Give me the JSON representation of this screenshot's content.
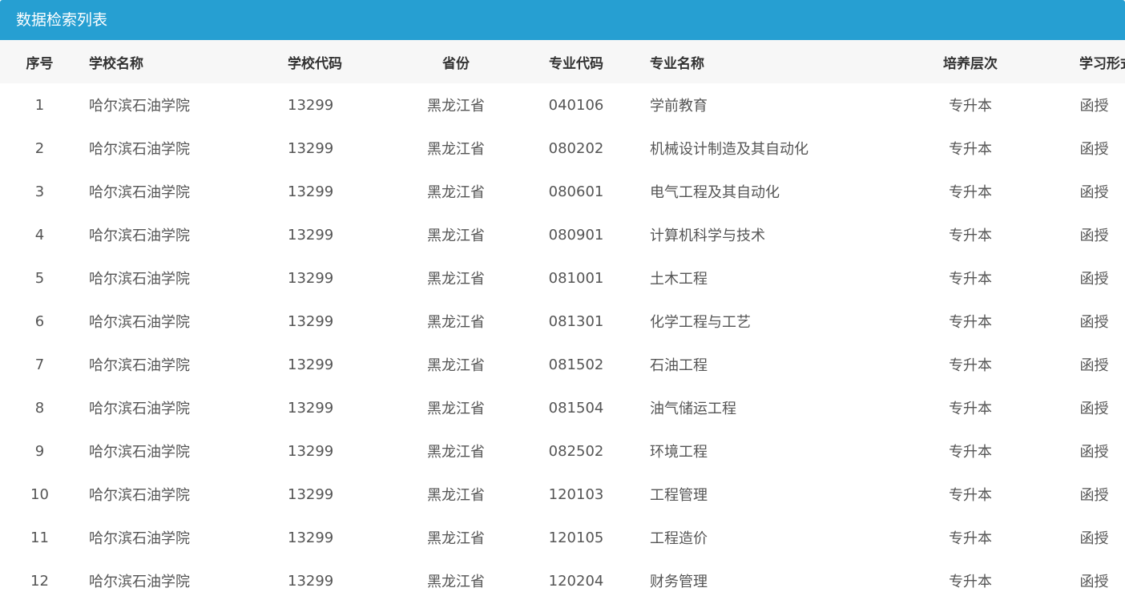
{
  "panel": {
    "title": "数据检索列表"
  },
  "columns": [
    "序号",
    "学校名称",
    "学校代码",
    "省份",
    "专业代码",
    "专业名称",
    "培养层次",
    "学习形式"
  ],
  "rows": [
    {
      "idx": "1",
      "school": "哈尔滨石油学院",
      "code": "13299",
      "province": "黑龙江省",
      "major_code": "040106",
      "major_name": "学前教育",
      "level": "专升本",
      "form": "函授"
    },
    {
      "idx": "2",
      "school": "哈尔滨石油学院",
      "code": "13299",
      "province": "黑龙江省",
      "major_code": "080202",
      "major_name": "机械设计制造及其自动化",
      "level": "专升本",
      "form": "函授"
    },
    {
      "idx": "3",
      "school": "哈尔滨石油学院",
      "code": "13299",
      "province": "黑龙江省",
      "major_code": "080601",
      "major_name": "电气工程及其自动化",
      "level": "专升本",
      "form": "函授"
    },
    {
      "idx": "4",
      "school": "哈尔滨石油学院",
      "code": "13299",
      "province": "黑龙江省",
      "major_code": "080901",
      "major_name": "计算机科学与技术",
      "level": "专升本",
      "form": "函授"
    },
    {
      "idx": "5",
      "school": "哈尔滨石油学院",
      "code": "13299",
      "province": "黑龙江省",
      "major_code": "081001",
      "major_name": "土木工程",
      "level": "专升本",
      "form": "函授"
    },
    {
      "idx": "6",
      "school": "哈尔滨石油学院",
      "code": "13299",
      "province": "黑龙江省",
      "major_code": "081301",
      "major_name": "化学工程与工艺",
      "level": "专升本",
      "form": "函授"
    },
    {
      "idx": "7",
      "school": "哈尔滨石油学院",
      "code": "13299",
      "province": "黑龙江省",
      "major_code": "081502",
      "major_name": "石油工程",
      "level": "专升本",
      "form": "函授"
    },
    {
      "idx": "8",
      "school": "哈尔滨石油学院",
      "code": "13299",
      "province": "黑龙江省",
      "major_code": "081504",
      "major_name": "油气储运工程",
      "level": "专升本",
      "form": "函授"
    },
    {
      "idx": "9",
      "school": "哈尔滨石油学院",
      "code": "13299",
      "province": "黑龙江省",
      "major_code": "082502",
      "major_name": "环境工程",
      "level": "专升本",
      "form": "函授"
    },
    {
      "idx": "10",
      "school": "哈尔滨石油学院",
      "code": "13299",
      "province": "黑龙江省",
      "major_code": "120103",
      "major_name": "工程管理",
      "level": "专升本",
      "form": "函授"
    },
    {
      "idx": "11",
      "school": "哈尔滨石油学院",
      "code": "13299",
      "province": "黑龙江省",
      "major_code": "120105",
      "major_name": "工程造价",
      "level": "专升本",
      "form": "函授"
    },
    {
      "idx": "12",
      "school": "哈尔滨石油学院",
      "code": "13299",
      "province": "黑龙江省",
      "major_code": "120204",
      "major_name": "财务管理",
      "level": "专升本",
      "form": "函授"
    }
  ],
  "colors": {
    "header_bar": "#269fd2",
    "table_head_bg": "#f7f7f7",
    "body_text": "#555555"
  }
}
